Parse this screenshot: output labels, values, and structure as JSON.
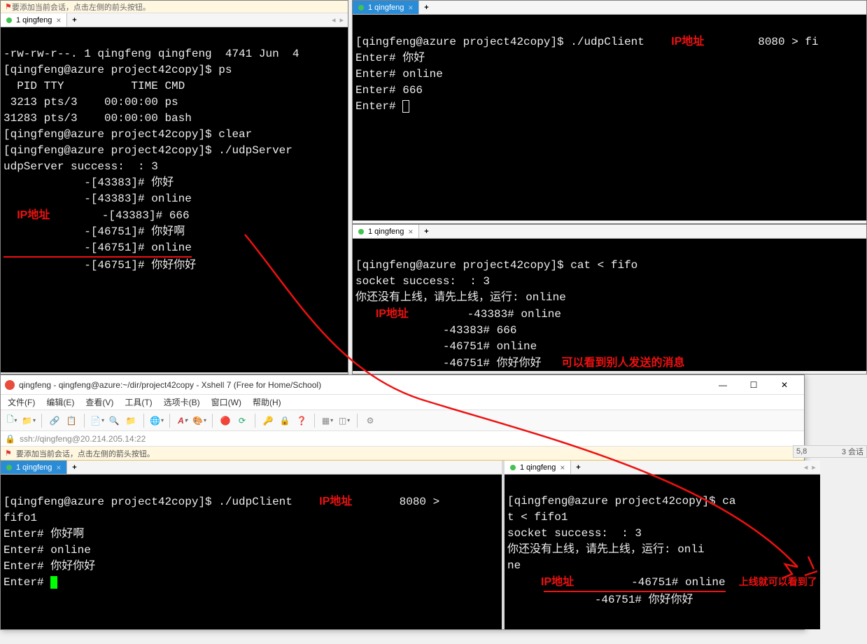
{
  "tab_label": "1 qingfeng",
  "tab_add": "+",
  "nav_prev": "◂",
  "nav_next": "▸",
  "annot": {
    "ip": "IP地址",
    "see_others": "可以看到别人发送的消息",
    "now_online": "上线就可以看到了"
  },
  "pane_tl": {
    "hint_prefix": "◗ ",
    "hint_text_partial": " 要添加当前会话，点击左侧的前头按钮。",
    "lines": [
      "-rw-rw-r--. 1 qingfeng qingfeng  4741 Jun  4 ",
      "[qingfeng@azure project42copy]$ ps",
      "  PID TTY          TIME CMD",
      " 3213 pts/3    00:00:00 ps",
      "31283 pts/3    00:00:00 bash",
      "[qingfeng@azure project42copy]$ clear",
      "[qingfeng@azure project42copy]$ ./udpServer ",
      "udpServer success:  : 3",
      "            -[43383]# 你好",
      "            -[43383]# online",
      "            -[43383]# 666",
      "            -[46751]# 你好啊",
      "            -[46751]# online",
      "            -[46751]# 你好你好"
    ]
  },
  "pane_tr": {
    "cmd": "[qingfeng@azure project42copy]$ ./udpClient",
    "port_frag": "8080 > fi",
    "lines": [
      "Enter# 你好",
      "Enter# online",
      "Enter# 666",
      "Enter# "
    ]
  },
  "pane_mr": {
    "cmd": "[qingfeng@azure project42copy]$ cat < fifo",
    "lines": [
      "socket success:  : 3",
      "你还没有上线，请先上线，运行: online",
      "             -43383# online",
      "             -43383# 666",
      "             -46751# online",
      "             -46751# 你好你好"
    ]
  },
  "xshell": {
    "title": "qingfeng - qingfeng@azure:~/dir/project42copy - Xshell 7 (Free for Home/School)",
    "menu": [
      "文件(F)",
      "编辑(E)",
      "查看(V)",
      "工具(T)",
      "选项卡(B)",
      "窗口(W)",
      "帮助(H)"
    ],
    "addr": "ssh://qingfeng@20.214.205.14:22",
    "hint": "要添加当前会话，点击左侧的箭头按钮。",
    "win": {
      "min": "—",
      "max": "☐",
      "close": "✕"
    }
  },
  "pane_bl": {
    "cmd": "[qingfeng@azure project42copy]$ ./udpClient",
    "port_frag": "8080 > ",
    "lines": [
      "fifo1",
      "Enter# 你好啊",
      "Enter# online",
      "Enter# 你好你好",
      "Enter# "
    ]
  },
  "pane_br": {
    "lines": [
      "[qingfeng@azure project42copy]$ ca",
      "t < fifo1",
      "socket success:  : 3",
      "你还没有上线，请先上线，运行: onli",
      "ne",
      "             -46751# online",
      "             -46751# 你好你好"
    ]
  },
  "status_strip": {
    "left": "5,8",
    "right": "3 会话"
  },
  "icons": {
    "lock": "🔒",
    "globe": "🌐",
    "folder": "📁",
    "new": "🗋",
    "copy": "📋",
    "paste": "📄",
    "search": "🔍",
    "font": "A",
    "color": "🎨",
    "red": "🔴",
    "refresh": "⟳",
    "key": "🔑",
    "grid": "▦",
    "split": "◫",
    "gear": "⚙",
    "help": "❓",
    "link": "🔗",
    "flag": "⚑"
  }
}
